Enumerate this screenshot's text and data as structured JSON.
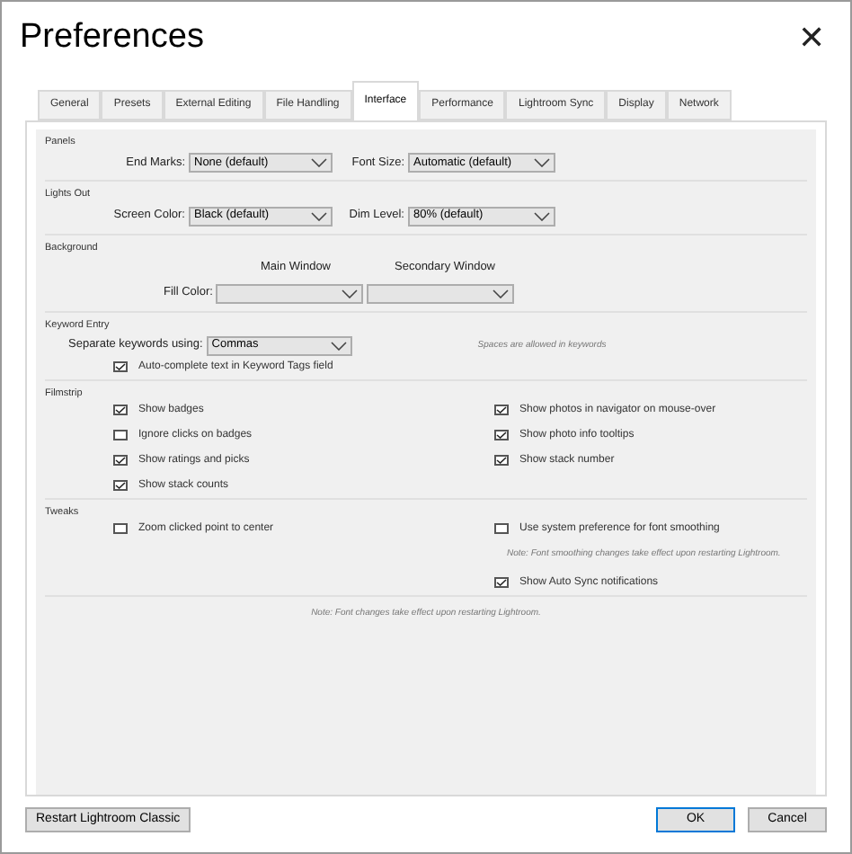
{
  "window": {
    "title": "Preferences",
    "close": "✕"
  },
  "tabs": [
    {
      "label": "General",
      "selected": false
    },
    {
      "label": "Presets",
      "selected": false
    },
    {
      "label": "External Editing",
      "selected": false
    },
    {
      "label": "File Handling",
      "selected": false
    },
    {
      "label": "Interface",
      "selected": true
    },
    {
      "label": "Performance",
      "selected": false
    },
    {
      "label": "Lightroom Sync",
      "selected": false
    },
    {
      "label": "Display",
      "selected": false
    },
    {
      "label": "Network",
      "selected": false
    }
  ],
  "sections": [
    {
      "title": "Panels",
      "kind": "pair",
      "left": {
        "label": "End Marks:",
        "value": "None (default)"
      },
      "right": {
        "label": "Font Size:",
        "value": "Automatic (default)"
      }
    },
    {
      "title": "Lights Out",
      "kind": "pair",
      "left": {
        "label": "Screen Color:",
        "value": "Black (default)"
      },
      "right": {
        "label": "Dim Level:",
        "value": "80% (default)"
      }
    },
    {
      "title": "Background",
      "kind": "background",
      "columns": [
        "Main Window",
        "Secondary Window"
      ],
      "label": "Fill Color:"
    },
    {
      "title": "Keyword Entry",
      "kind": "keyword",
      "select": {
        "label": "Separate keywords using:",
        "value": "Commas"
      },
      "note": "Spaces are allowed in keywords",
      "checkbox": {
        "label": "Auto-complete text in Keyword Tags field",
        "checked": true
      }
    },
    {
      "title": "Filmstrip",
      "kind": "checks",
      "left": [
        {
          "label": "Show badges",
          "checked": true
        },
        {
          "label": "Ignore clicks on badges",
          "checked": false
        },
        {
          "label": "Show ratings and picks",
          "checked": true
        },
        {
          "label": "Show stack counts",
          "checked": true
        }
      ],
      "right": [
        {
          "kind": "checkbox",
          "label": "Show photos in navigator on mouse-over",
          "checked": true
        },
        {
          "kind": "checkbox",
          "label": "Show photo info tooltips",
          "checked": true
        },
        {
          "kind": "checkbox",
          "label": "Show stack number",
          "checked": true
        }
      ]
    },
    {
      "title": "Tweaks",
      "kind": "checks",
      "left": [
        {
          "label": "Zoom clicked point to center",
          "checked": false
        }
      ],
      "right": [
        {
          "kind": "checkbox",
          "label": "Use system preference for font smoothing",
          "checked": false
        },
        {
          "kind": "note",
          "label": "Note: Font smoothing changes take effect upon restarting Lightroom."
        },
        {
          "kind": "checkbox",
          "label": "Show Auto Sync notifications",
          "checked": true
        }
      ]
    }
  ],
  "footer_note": "Note: Font changes take effect upon restarting Lightroom.",
  "buttons": {
    "restart": "Restart Lightroom Classic",
    "ok": "OK",
    "cancel": "Cancel"
  }
}
